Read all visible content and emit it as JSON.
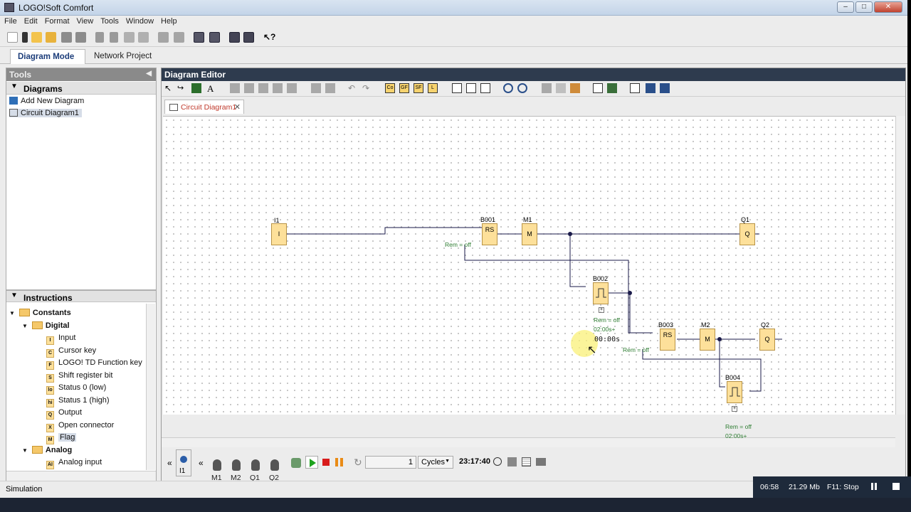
{
  "app": {
    "title": "LOGO!Soft Comfort"
  },
  "menu": [
    "File",
    "Edit",
    "Format",
    "View",
    "Tools",
    "Window",
    "Help"
  ],
  "mode_tabs": [
    {
      "label": "Diagram Mode",
      "active": true
    },
    {
      "label": "Network Project",
      "active": false
    }
  ],
  "tools": {
    "header": "Tools",
    "diagrams": {
      "title": "Diagrams",
      "items": [
        "Add New Diagram",
        "Circuit Diagram1"
      ]
    },
    "instructions": {
      "title": "Instructions",
      "constants": "Constants",
      "digital": "Digital",
      "digital_items": [
        {
          "code": "I",
          "label": "Input"
        },
        {
          "code": "C",
          "label": "Cursor key"
        },
        {
          "code": "F",
          "label": "LOGO! TD Function key"
        },
        {
          "code": "S",
          "label": "Shift register bit"
        },
        {
          "code": "lo",
          "label": "Status 0 (low)"
        },
        {
          "code": "hi",
          "label": "Status 1 (high)"
        },
        {
          "code": "Q",
          "label": "Output"
        },
        {
          "code": "X",
          "label": "Open connector"
        },
        {
          "code": "M",
          "label": "Flag"
        }
      ],
      "analog": "Analog",
      "analog_items": [
        {
          "code": "AI",
          "label": "Analog input"
        }
      ]
    }
  },
  "editor": {
    "header": "Diagram Editor",
    "tab": "Circuit Diagram1",
    "toolbar_text": [
      "A",
      "Co",
      "GF",
      "SF",
      "L"
    ],
    "blocks": {
      "I1": {
        "label": "I1",
        "inner": "I"
      },
      "B001": {
        "label": "B001",
        "inner": "RS",
        "rem": "Rem = off"
      },
      "M1": {
        "label": "M1",
        "inner": "M"
      },
      "Q1": {
        "label": "Q1",
        "inner": "Q"
      },
      "B002": {
        "label": "B002",
        "rem": "Rem = off",
        "time": "02:00s+",
        "timer": "00:00s"
      },
      "B003": {
        "label": "B003",
        "inner": "RS",
        "rem": "Rem = off"
      },
      "M2": {
        "label": "M2",
        "inner": "M"
      },
      "Q2": {
        "label": "Q2",
        "inner": "Q"
      },
      "B004": {
        "label": "B004",
        "rem": "Rem = off",
        "time": "02:00s+"
      }
    }
  },
  "simulation": {
    "inputs": [
      "I1"
    ],
    "outputs": [
      "M1",
      "M2",
      "Q1",
      "Q2"
    ],
    "cycles_value": "1",
    "cycles_unit": "Cycles",
    "time": "23:17:40"
  },
  "status": {
    "text": "Simulation",
    "clock": "06:58",
    "memory": "21.29 Mb",
    "mode": "F11: Stop"
  }
}
